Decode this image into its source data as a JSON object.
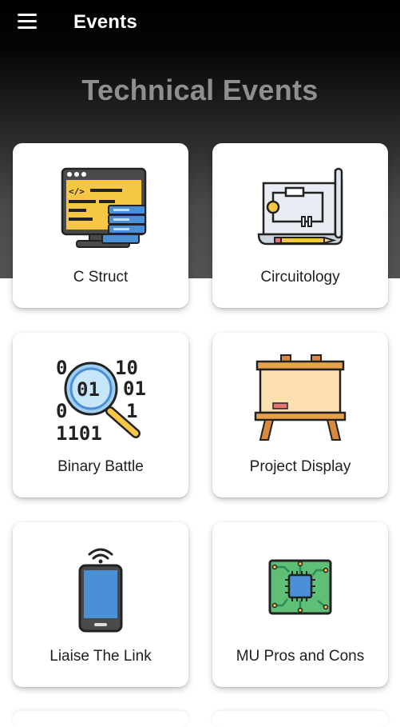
{
  "app_bar": {
    "title": "Events",
    "menu_icon": "hamburger-menu-icon"
  },
  "section": {
    "title": "Technical Events"
  },
  "events": [
    {
      "label": "C Struct",
      "icon": "code-server-icon"
    },
    {
      "label": "Circuitology",
      "icon": "circuit-blueprint-icon"
    },
    {
      "label": "Binary Battle",
      "icon": "binary-magnifier-icon"
    },
    {
      "label": "Project Display",
      "icon": "display-board-icon"
    },
    {
      "label": "Liaise The Link",
      "icon": "smartphone-wifi-icon"
    },
    {
      "label": "MU Pros and Cons",
      "icon": "circuit-board-chip-icon"
    }
  ],
  "colors": {
    "app_bar_background": "#000000",
    "hero_gradient_end": "#525252",
    "section_title": "#8f8f8f",
    "card_background": "#ffffff"
  }
}
